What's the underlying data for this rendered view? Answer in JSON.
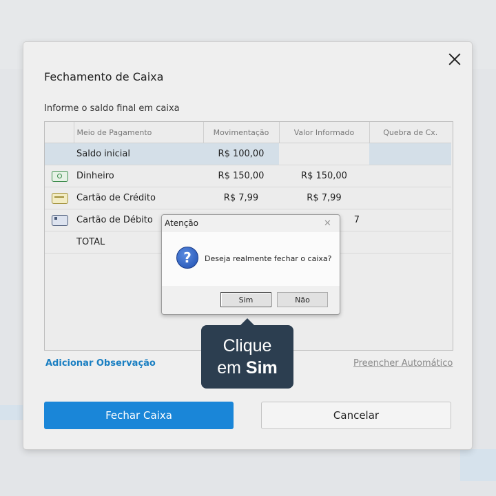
{
  "dialog": {
    "title": "Fechamento de Caixa",
    "subtitle": "Informe o saldo final em caixa",
    "close_icon": "close-icon"
  },
  "table": {
    "columns": [
      "Meio de Pagamento",
      "Movimentação",
      "Valor Informado",
      "Quebra de Cx."
    ],
    "rows": [
      {
        "icon": "",
        "label": "Saldo inicial",
        "movimentacao": "R$ 100,00",
        "informado": "",
        "quebra": ""
      },
      {
        "icon": "cash-icon",
        "label": "Dinheiro",
        "movimentacao": "R$ 150,00",
        "informado": "R$ 150,00",
        "quebra": ""
      },
      {
        "icon": "credit-card-icon",
        "label": "Cartão de Crédito",
        "movimentacao": "R$ 7,99",
        "informado": "R$ 7,99",
        "quebra": ""
      },
      {
        "icon": "debit-card-icon",
        "label": "Cartão de Débito",
        "movimentacao": "",
        "informado": "7",
        "quebra": ""
      },
      {
        "icon": "",
        "label": "TOTAL",
        "movimentacao": "",
        "informado": "",
        "quebra": ""
      }
    ]
  },
  "links": {
    "add_observation": "Adicionar Observação",
    "auto_fill": "Preencher Automático"
  },
  "buttons": {
    "close_register": "Fechar Caixa",
    "cancel": "Cancelar"
  },
  "message_box": {
    "title": "Atenção",
    "close_glyph": "✕",
    "icon": "question-icon",
    "question_glyph": "?",
    "text": "Deseja realmente fechar o caixa?",
    "yes": "Sim",
    "no": "Não"
  },
  "tooltip": {
    "line1": "Clique",
    "line2_prefix": "em ",
    "line2_bold": "Sim"
  },
  "colors": {
    "primary": "#1a86d8",
    "link": "#1a7fc2",
    "highlight_row": "#d4dfe8",
    "tooltip_bg": "#2c3e50"
  }
}
